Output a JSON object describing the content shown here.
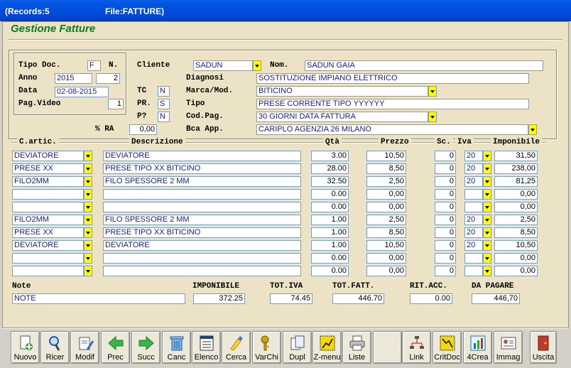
{
  "window": {
    "records": "(Records:5",
    "file": "File:FATTURE)"
  },
  "app_title": "Gestione Fatture",
  "header": {
    "tipo_doc_label": "Tipo Doc.",
    "tipo_doc": "F",
    "n_label": "N.",
    "anno_label": "Anno",
    "anno": "2015",
    "numero": "2",
    "data_label": "Data",
    "data": "02-08-2015",
    "pag_video_label": "Pag.Video",
    "pag_video": "1",
    "ra_label": "% RA",
    "ra": "0,00",
    "cliente_label": "Cliente",
    "cliente": "SADUN",
    "nom_label": "Nom.",
    "nom": "SADUN  GAIA",
    "diagnosi_label": "Diagnosi",
    "diagnosi": "SOSTITUZIONE IMPIANO ELETTRICO",
    "tc_label": "TC",
    "tc": "N",
    "marca_label": "Marca/Mod.",
    "marca": "BITICINO",
    "pr_label": "PR.",
    "pr": "S",
    "tipo_label": "Tipo",
    "tipo": "PRESE CORRENTE TIPO YYYYYY",
    "p_label": "P?",
    "p": "N",
    "codpag_label": "Cod.Pag.",
    "codpag": "30 GIORNI DATA FATTURA",
    "bca_label": "Bca App.",
    "bca": "CARIPLO     AGENZIA 26    MILANO"
  },
  "columns": {
    "articolo": "C.artic.",
    "descrizione": "Descrizione",
    "qta": "Qtà",
    "prezzo": "Prezzo",
    "sconto": "Sc.",
    "iva": "Iva",
    "imponibile": "Imponibile"
  },
  "rows": [
    {
      "art": "DEVIATORE",
      "desc": "DEVIATORE",
      "qta": "3.00",
      "prezzo": "10,50",
      "sc": "0",
      "iva": "20",
      "imp": "31,50"
    },
    {
      "art": "PRESE XX",
      "desc": "PRESE TIPO XX BITICINO",
      "qta": "28.00",
      "prezzo": "8,50",
      "sc": "0",
      "iva": "20",
      "imp": "238,00"
    },
    {
      "art": "FILO2MM",
      "desc": "FILO SPESSORE 2 MM",
      "qta": "32.50",
      "prezzo": "2,50",
      "sc": "0",
      "iva": "20",
      "imp": "81,25"
    },
    {
      "art": "",
      "desc": "",
      "qta": "0.00",
      "prezzo": "0,00",
      "sc": "0",
      "iva": "",
      "imp": "0,00"
    },
    {
      "art": "",
      "desc": "",
      "qta": "0.00",
      "prezzo": "0,00",
      "sc": "0",
      "iva": "",
      "imp": "0,00"
    },
    {
      "art": "FILO2MM",
      "desc": "FILO SPESSORE 2 MM",
      "qta": "1.00",
      "prezzo": "2,50",
      "sc": "0",
      "iva": "20",
      "imp": "2,50"
    },
    {
      "art": "PRESE XX",
      "desc": "PRESE TIPO XX BITICINO",
      "qta": "1.00",
      "prezzo": "8,50",
      "sc": "0",
      "iva": "20",
      "imp": "8,50"
    },
    {
      "art": "DEVIATORE",
      "desc": "DEVIATORE",
      "qta": "1.00",
      "prezzo": "10,50",
      "sc": "0",
      "iva": "20",
      "imp": "10,50"
    },
    {
      "art": "",
      "desc": "",
      "qta": "0.00",
      "prezzo": "0,00",
      "sc": "0",
      "iva": "",
      "imp": "0,00"
    },
    {
      "art": "",
      "desc": "",
      "qta": "0.00",
      "prezzo": "0,00",
      "sc": "0",
      "iva": "",
      "imp": "0,00"
    }
  ],
  "footer": {
    "note_label": "Note",
    "note": "NOTE",
    "imponibile_label": "IMPONIBILE",
    "imponibile": "372.25",
    "totiva_label": "TOT.IVA",
    "totiva": "74.45",
    "totfatt_label": "TOT.FATT.",
    "totfatt": "446.70",
    "ritacc_label": "RIT.ACC.",
    "ritacc": "0.00",
    "dapagare_label": "DA PAGARE",
    "dapagare": "446,70"
  },
  "toolbar": [
    {
      "label": "Nuovo",
      "icon": "new-icon"
    },
    {
      "label": "Ricer",
      "icon": "search-icon"
    },
    {
      "label": "Modif",
      "icon": "edit-icon"
    },
    {
      "label": "Prec",
      "icon": "arrow-left-icon"
    },
    {
      "label": "Succ",
      "icon": "arrow-right-icon"
    },
    {
      "label": "Canc",
      "icon": "trash-icon"
    },
    {
      "label": "Elenco",
      "icon": "list-icon"
    },
    {
      "label": "Cerca",
      "icon": "find-icon"
    },
    {
      "label": "VarChi",
      "icon": "keys-icon"
    },
    {
      "label": "Dupl",
      "icon": "duplicate-icon"
    },
    {
      "label": "Z-menu",
      "icon": "zmenu-icon"
    },
    {
      "label": "Liste",
      "icon": "printer-icon"
    },
    {
      "label": "",
      "icon": ""
    },
    {
      "label": "Link",
      "icon": "link-icon"
    },
    {
      "label": "CritDoc",
      "icon": "critdoc-icon"
    },
    {
      "label": "4Crea",
      "icon": "create-icon"
    },
    {
      "label": "Immag",
      "icon": "image-icon"
    },
    {
      "label": "Uscita",
      "icon": "exit-icon"
    }
  ],
  "colors": {
    "title_green": "#0a7a1a",
    "panel": "#ece3c6",
    "dropdown_yellow": "#ffff00",
    "titlebar_blue": "#0054e3"
  }
}
